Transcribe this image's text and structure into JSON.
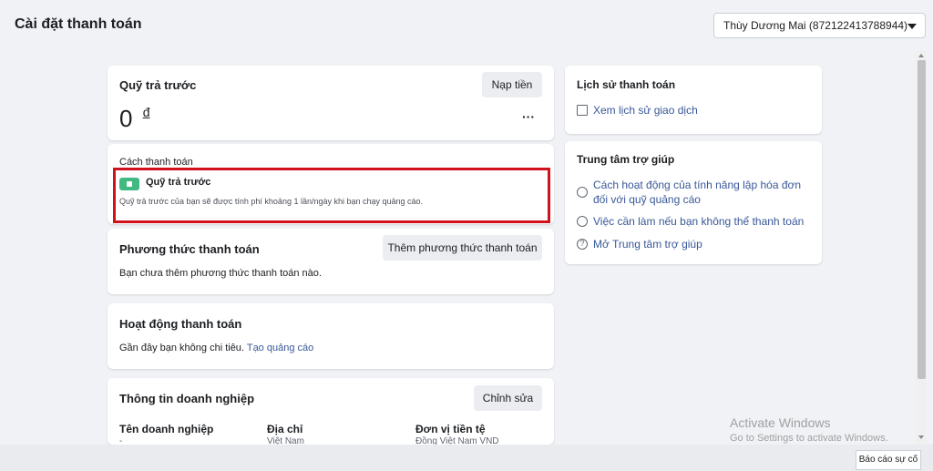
{
  "page": {
    "title": "Cài đặt thanh toán",
    "account_select": "Thùy Dương Mai (872122413788944)"
  },
  "prepaid": {
    "title": "Quỹ trả trước",
    "add_funds_button": "Nạp tiền",
    "balance": "0",
    "currency_symbol": "đ",
    "more_icon": "more-icon",
    "payment_method_label": "Cách thanh toán",
    "method_name": "Quỹ trả trước",
    "method_desc": "Quỹ trả trước của bạn sẽ được tính phí khoảng 1 lần/ngày khi bạn chạy quảng cáo."
  },
  "payment_methods": {
    "title": "Phương thức thanh toán",
    "add_button": "Thêm phương thức thanh toán",
    "empty_text": "Bạn chưa thêm phương thức thanh toán nào."
  },
  "activity": {
    "title": "Hoạt động thanh toán",
    "text": "Gần đây bạn không chi tiêu.",
    "link": "Tạo quảng cáo"
  },
  "business_info": {
    "title": "Thông tin doanh nghiệp",
    "edit_button": "Chỉnh sửa",
    "columns": [
      {
        "label": "Tên doanh nghiệp",
        "value": "-"
      },
      {
        "label": "Địa chỉ",
        "value": "Việt Nam"
      },
      {
        "label": "Đơn vị tiền tệ",
        "value": "Đồng Việt Nam VND"
      }
    ]
  },
  "history": {
    "title": "Lịch sử thanh toán",
    "link": "Xem lịch sử giao dịch"
  },
  "help": {
    "title": "Trung tâm trợ giúp",
    "links": [
      "Cách hoạt động của tính năng lập hóa đơn đối với quỹ quảng cáo",
      "Việc cần làm nếu bạn không thể thanh toán",
      "Mở Trung tâm trợ giúp"
    ]
  },
  "watermark": {
    "line1": "Activate Windows",
    "line2": "Go to Settings to activate Windows."
  },
  "footer": {
    "report_button": "Báo cáo sự cố"
  },
  "colors": {
    "accent": "#385898",
    "highlight": "#d0121d",
    "wallet": "#42b883"
  }
}
